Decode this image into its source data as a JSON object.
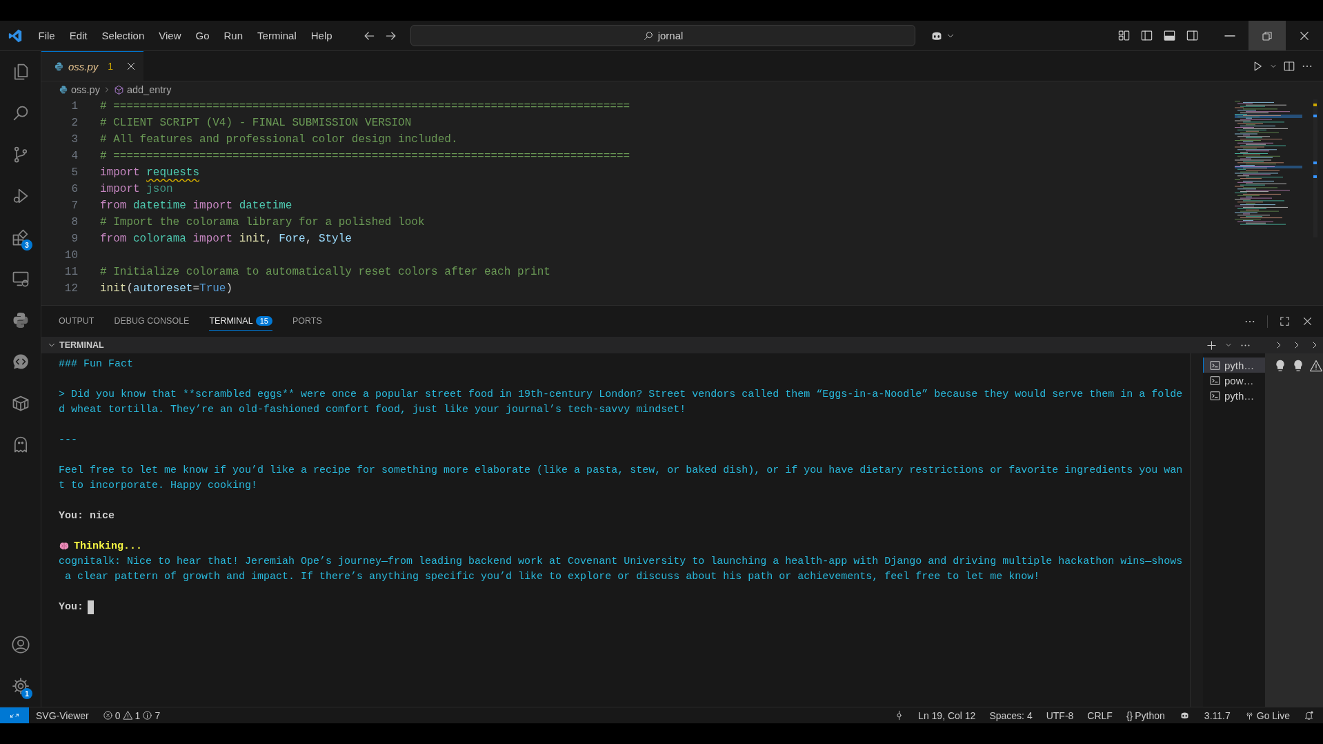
{
  "title_bar": {
    "menu": [
      "File",
      "Edit",
      "Selection",
      "View",
      "Go",
      "Run",
      "Terminal",
      "Help"
    ],
    "search": {
      "value": "jornal"
    },
    "window_buttons": [
      {
        "kind": "minimize",
        "hovered": false
      },
      {
        "kind": "restore",
        "hovered": true
      },
      {
        "kind": "close",
        "hovered": false
      }
    ]
  },
  "activity_bar": {
    "extensions_badge": "3",
    "settings_badge": "1"
  },
  "editor_tabs": [
    {
      "label": "oss.py",
      "problems": "1",
      "selected": true
    }
  ],
  "breadcrumb": {
    "file": "oss.py",
    "symbol": "add_entry"
  },
  "code_lines": [
    {
      "number": "1",
      "tokens": [
        {
          "kind": "comment",
          "text": "# =============================================================================="
        }
      ]
    },
    {
      "number": "2",
      "tokens": [
        {
          "kind": "comment",
          "text": "# CLIENT SCRIPT (V4) - FINAL SUBMISSION VERSION"
        }
      ]
    },
    {
      "number": "3",
      "tokens": [
        {
          "kind": "comment",
          "text": "# All features and professional color design included."
        }
      ]
    },
    {
      "number": "4",
      "tokens": [
        {
          "kind": "comment",
          "text": "# =============================================================================="
        }
      ]
    },
    {
      "number": "5",
      "tokens": [
        {
          "kind": "keyword",
          "text": "import "
        },
        {
          "kind": "module-warning",
          "text": "requests"
        }
      ]
    },
    {
      "number": "6",
      "tokens": [
        {
          "kind": "keyword",
          "text": "import "
        },
        {
          "kind": "module-unused",
          "text": "json"
        }
      ]
    },
    {
      "number": "7",
      "tokens": [
        {
          "kind": "keyword",
          "text": "from "
        },
        {
          "kind": "module",
          "text": "datetime "
        },
        {
          "kind": "keyword",
          "text": "import "
        },
        {
          "kind": "module",
          "text": "datetime"
        }
      ]
    },
    {
      "number": "8",
      "tokens": [
        {
          "kind": "comment",
          "text": "# Import the colorama library for a polished look"
        }
      ]
    },
    {
      "number": "9",
      "tokens": [
        {
          "kind": "keyword",
          "text": "from "
        },
        {
          "kind": "module",
          "text": "colorama "
        },
        {
          "kind": "keyword",
          "text": "import "
        },
        {
          "kind": "function",
          "text": "init"
        },
        {
          "kind": "plain",
          "text": ", "
        },
        {
          "kind": "variable",
          "text": "Fore"
        },
        {
          "kind": "plain",
          "text": ", "
        },
        {
          "kind": "variable",
          "text": "Style"
        }
      ]
    },
    {
      "number": "10"
    },
    {
      "number": "11",
      "tokens": [
        {
          "kind": "comment",
          "text": "# Initialize colorama to automatically reset colors after each print"
        }
      ]
    },
    {
      "number": "12",
      "tokens": [
        {
          "kind": "function",
          "text": "init"
        },
        {
          "kind": "plain",
          "text": "("
        },
        {
          "kind": "variable",
          "text": "autoreset"
        },
        {
          "kind": "plain",
          "text": "="
        },
        {
          "kind": "constant",
          "text": "True"
        },
        {
          "kind": "plain",
          "text": ")"
        }
      ]
    }
  ],
  "panel_tabs": [
    {
      "label": "OUTPUT",
      "selected": false
    },
    {
      "label": "DEBUG CONSOLE",
      "selected": false
    },
    {
      "label": "TERMINAL",
      "badge": "15",
      "selected": true
    },
    {
      "label": "PORTS",
      "selected": false
    }
  ],
  "terminal": {
    "title": "TERMINAL",
    "blocks": [
      [
        {
          "kind": "output",
          "text": "### Fun Fact"
        }
      ],
      [
        {
          "kind": "output",
          "text": "> Did you know that **scrambled eggs** were once a popular street food in 19th-century London? Street vendors called them “Eggs-in-a-Noodle” because they would serve them in a folde"
        },
        {
          "kind": "output",
          "text": "d wheat tortilla. They’re an old-fashioned comfort food, just like your journal’s tech-savvy mindset!"
        }
      ],
      [
        {
          "kind": "output",
          "text": "---"
        }
      ],
      [
        {
          "kind": "output",
          "text": "Feel free to let me know if you’d like a recipe for something more elaborate (like a pasta, stew, or baked dish), or if you have dietary restrictions or favorite ingredients you wan"
        },
        {
          "kind": "output",
          "text": "t to incorporate. Happy cooking!"
        }
      ],
      [
        {
          "kind": "user",
          "text": "You: nice"
        }
      ],
      [
        {
          "kind": "thinking",
          "text": "Thinking..."
        },
        {
          "kind": "output",
          "text": "cognitalk: Nice to hear that! Jeremiah Ope’s journey—from leading backend work at Covenant University to launching a health-app with Django and driving multiple hackathon wins—shows"
        },
        {
          "kind": "output",
          "text": " a clear pattern of growth and impact. If there’s anything specific you’d like to explore or discuss about his path or achievements, feel free to let me know!"
        }
      ],
      [
        {
          "kind": "prompt",
          "text": "You:"
        }
      ]
    ],
    "sessions": [
      {
        "label": "pyth…",
        "selected": true
      },
      {
        "label": "pow…",
        "selected": false
      },
      {
        "label": "pyth…",
        "selected": false
      }
    ]
  },
  "status_bar": {
    "left": [
      {
        "kind": "label",
        "text": "SVG-Viewer"
      },
      {
        "kind": "problems",
        "errors": "0",
        "warnings": "1",
        "infos": "7"
      }
    ],
    "right": [
      {
        "kind": "location"
      },
      {
        "kind": "label",
        "text": "Ln 19, Col 12"
      },
      {
        "kind": "label",
        "text": "Spaces: 4"
      },
      {
        "kind": "label",
        "text": "UTF-8"
      },
      {
        "kind": "label",
        "text": "CRLF"
      },
      {
        "kind": "language",
        "glyph": "{}",
        "text": "Python"
      },
      {
        "kind": "copilot"
      },
      {
        "kind": "label",
        "text": "3.11.7"
      },
      {
        "kind": "live",
        "text": "Go Live"
      },
      {
        "kind": "notifications"
      }
    ]
  }
}
